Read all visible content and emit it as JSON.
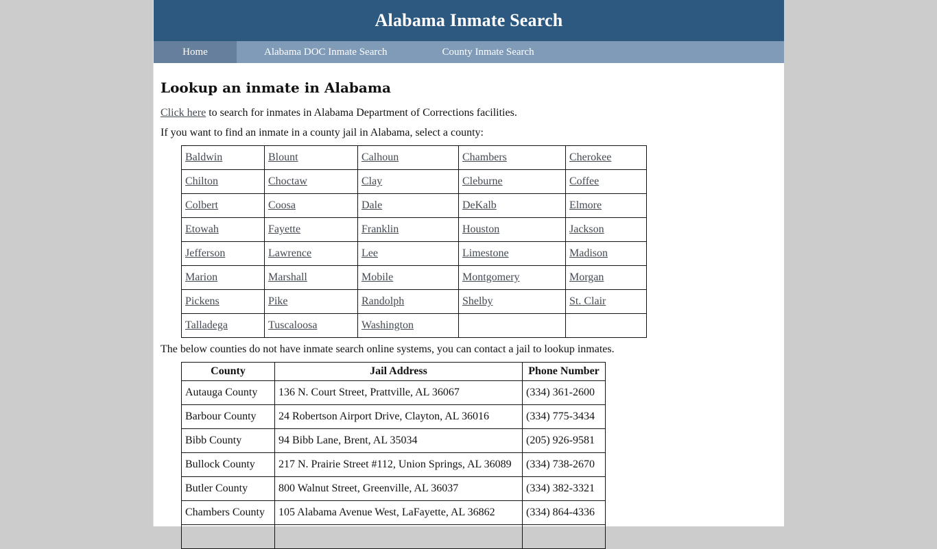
{
  "header": {
    "title": "Alabama Inmate Search"
  },
  "nav": {
    "items": [
      {
        "label": "Home",
        "active": true
      },
      {
        "label": "Alabama DOC Inmate Search",
        "active": false
      },
      {
        "label": "County Inmate Search",
        "active": false
      }
    ]
  },
  "main": {
    "heading": "Lookup an inmate in Alabama",
    "doc_link_label": "Click here",
    "doc_text": " to search for inmates in Alabama Department of Corrections facilities.",
    "county_intro": "If you want to find an inmate in a county jail in Alabama, select a county:",
    "county_grid": [
      [
        "Baldwin",
        "Blount",
        "Calhoun",
        "Chambers",
        "Cherokee"
      ],
      [
        "Chilton",
        "Choctaw",
        "Clay",
        "Cleburne",
        "Coffee"
      ],
      [
        "Colbert",
        "Coosa",
        "Dale",
        "DeKalb",
        "Elmore"
      ],
      [
        "Etowah",
        "Fayette",
        "Franklin",
        "Houston",
        "Jackson"
      ],
      [
        "Jefferson",
        "Lawrence",
        "Lee",
        "Limestone",
        "Madison"
      ],
      [
        "Marion",
        "Marshall",
        "Mobile",
        "Montgomery",
        "Morgan"
      ],
      [
        "Pickens",
        "Pike",
        "Randolph",
        "Shelby",
        "St. Clair"
      ],
      [
        "Talladega",
        "Tuscaloosa",
        "Washington",
        "",
        ""
      ]
    ],
    "no_online_text": "The below counties do not have inmate search online systems, you can contact a jail to lookup inmates.",
    "jail_table": {
      "headers": [
        "County",
        "Jail Address",
        "Phone Number"
      ],
      "rows": [
        [
          "Autauga County",
          "136 N. Court Street, Prattville, AL 36067",
          "(334) 361-2600"
        ],
        [
          "Barbour County",
          "24 Robertson Airport Drive, Clayton, AL 36016",
          "(334) 775-3434"
        ],
        [
          "Bibb County",
          "94 Bibb Lane, Brent, AL 35034",
          "(205) 926-9581"
        ],
        [
          "Bullock County",
          "217 N. Prairie Street #112, Union Springs, AL 36089",
          "(334) 738-2670"
        ],
        [
          "Butler County",
          "800 Walnut Street, Greenville, AL 36037",
          "(334) 382-3321"
        ],
        [
          "Chambers County",
          "105 Alabama Avenue West, LaFayette, AL 36862",
          "(334) 864-4336"
        ],
        [
          "",
          "",
          ""
        ]
      ]
    }
  }
}
